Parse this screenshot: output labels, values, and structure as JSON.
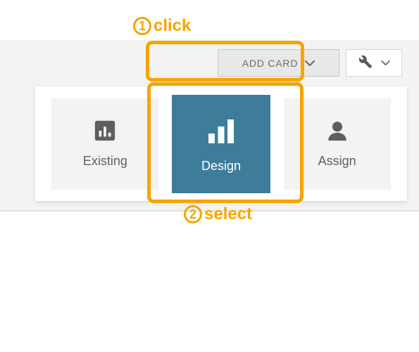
{
  "annotations": {
    "step1_num": "1",
    "step1_label": "click",
    "step2_num": "2",
    "step2_label": "select"
  },
  "toolbar": {
    "add_card_label": "ADD CARD"
  },
  "options": {
    "existing": {
      "label": "Existing"
    },
    "design": {
      "label": "Design"
    },
    "assign": {
      "label": "Assign"
    }
  },
  "colors": {
    "accent": "#f6a500",
    "selected_bg": "#3d7d9a"
  }
}
